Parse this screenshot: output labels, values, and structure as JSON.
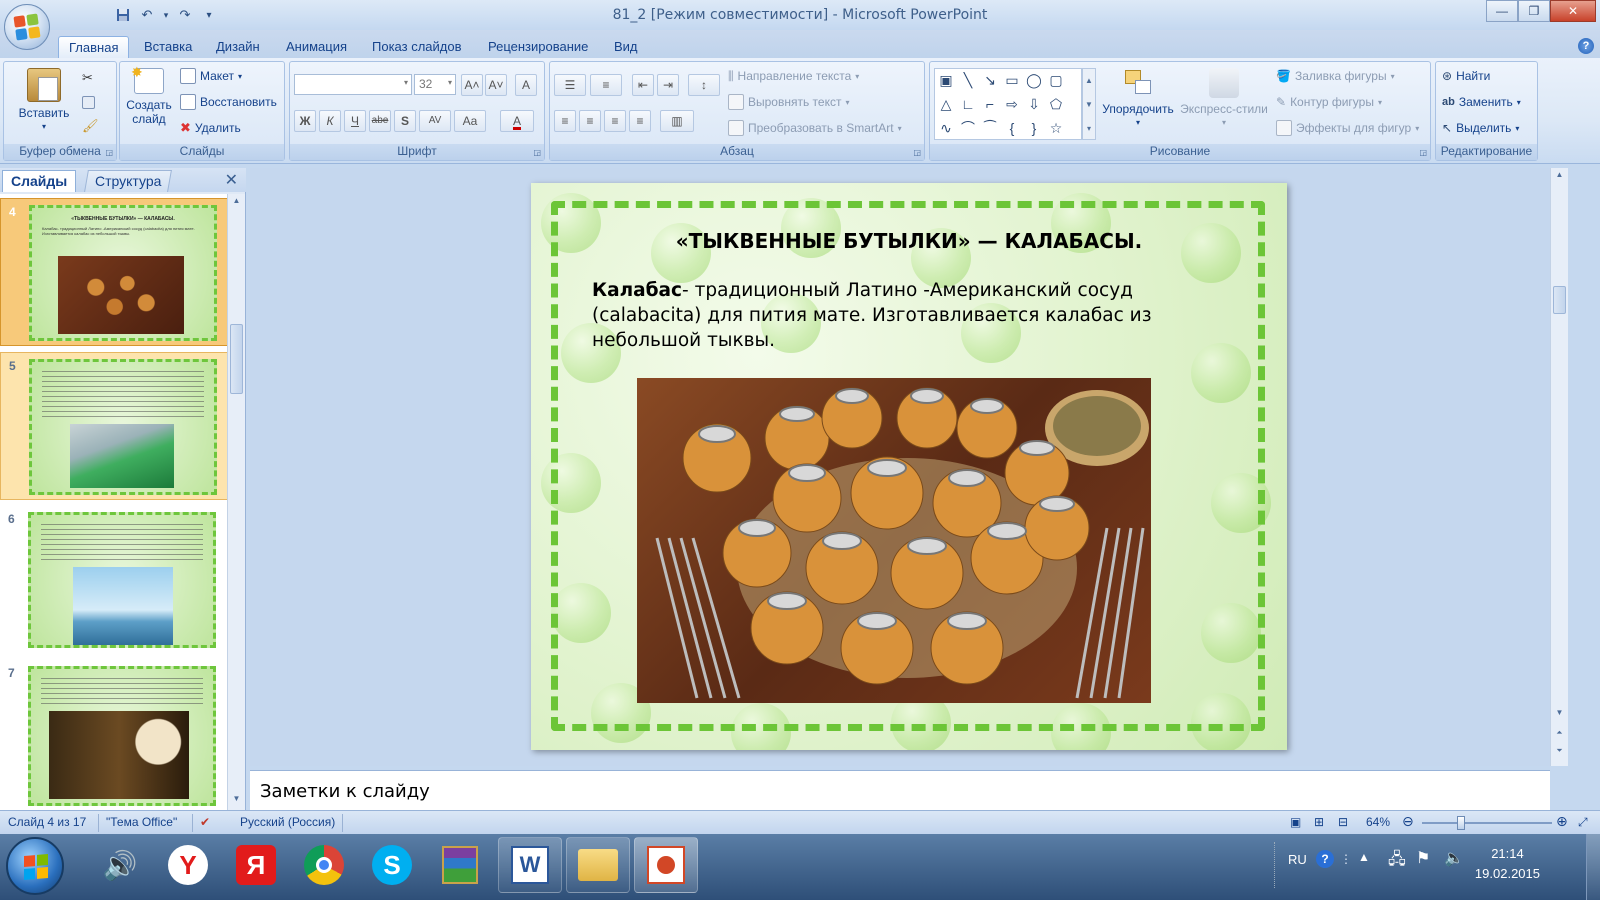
{
  "window": {
    "title": "81_2 [Режим совместимости] - Microsoft PowerPoint",
    "minimize": "—",
    "maximize": "❐",
    "close": "✕"
  },
  "qat": {
    "save": "💾",
    "undo": "↶",
    "redo": "↷",
    "customize": "▾"
  },
  "tabs": [
    "Главная",
    "Вставка",
    "Дизайн",
    "Анимация",
    "Показ слайдов",
    "Рецензирование",
    "Вид"
  ],
  "active_tab": "Главная",
  "ribbon": {
    "clipboard": {
      "label": "Буфер обмена",
      "paste": "Вставить"
    },
    "slides": {
      "label": "Слайды",
      "new_slide": "Создать слайд",
      "layout": "Макет",
      "reset": "Восстановить",
      "delete": "Удалить"
    },
    "font": {
      "label": "Шрифт",
      "font_name": "",
      "font_size": "32",
      "bold": "Ж",
      "italic": "К",
      "underline": "Ч",
      "strike": "abe",
      "shadow": "S",
      "spacing": "AV",
      "case": "Aa",
      "color": "A",
      "grow": "A˄",
      "shrink": "A˅",
      "clear": "A"
    },
    "paragraph": {
      "label": "Абзац",
      "direction": "Направление текста",
      "align_text": "Выровнять текст",
      "smartart": "Преобразовать в SmartArt"
    },
    "drawing": {
      "label": "Рисование",
      "arrange": "Упорядочить",
      "quick_styles": "Экспресс-стили",
      "fill": "Заливка фигуры",
      "outline": "Контур фигуры",
      "effects": "Эффекты для фигур"
    },
    "editing": {
      "label": "Редактирование",
      "find": "Найти",
      "replace": "Заменить",
      "select": "Выделить"
    }
  },
  "left_pane": {
    "tab_slides": "Слайды",
    "tab_outline": "Структура",
    "close": "✕",
    "thumbnails": [
      {
        "number": "4",
        "title": "«ТЫКВЕННЫЕ БУТЫЛКИ» — КАЛАБАСЫ.",
        "text": "Калабас- традиционный Латино -Американский сосуд (calabacita) для пития мате. Изготавливается калабас из небольшой тыквы."
      },
      {
        "number": "5",
        "title": "",
        "text": ""
      },
      {
        "number": "6",
        "title": "",
        "text": ""
      },
      {
        "number": "7",
        "title": "",
        "text": ""
      }
    ]
  },
  "slide": {
    "title": "«ТЫКВЕННЫЕ БУТЫЛКИ» — КАЛАБАСЫ.",
    "body_bold": "Калабас",
    "body_rest": "- традиционный Латино -Американский сосуд (calabacita) для пития мате. Изготавливается калабас из небольшой тыквы."
  },
  "notes": {
    "placeholder": "Заметки к слайду"
  },
  "status": {
    "slide_info": "Слайд 4 из 17",
    "theme": "\"Тема Office\"",
    "language": "Русский (Россия)",
    "zoom": "64%",
    "zoom_level": 0.64
  },
  "taskbar": {
    "lang": "RU",
    "time": "21:14",
    "date": "19.02.2015"
  },
  "colors": {
    "ribbon_text": "#15428b",
    "slide_border": "#6cc537",
    "selected_thumb": "#f7c97a",
    "close_button": "#c8422b"
  }
}
